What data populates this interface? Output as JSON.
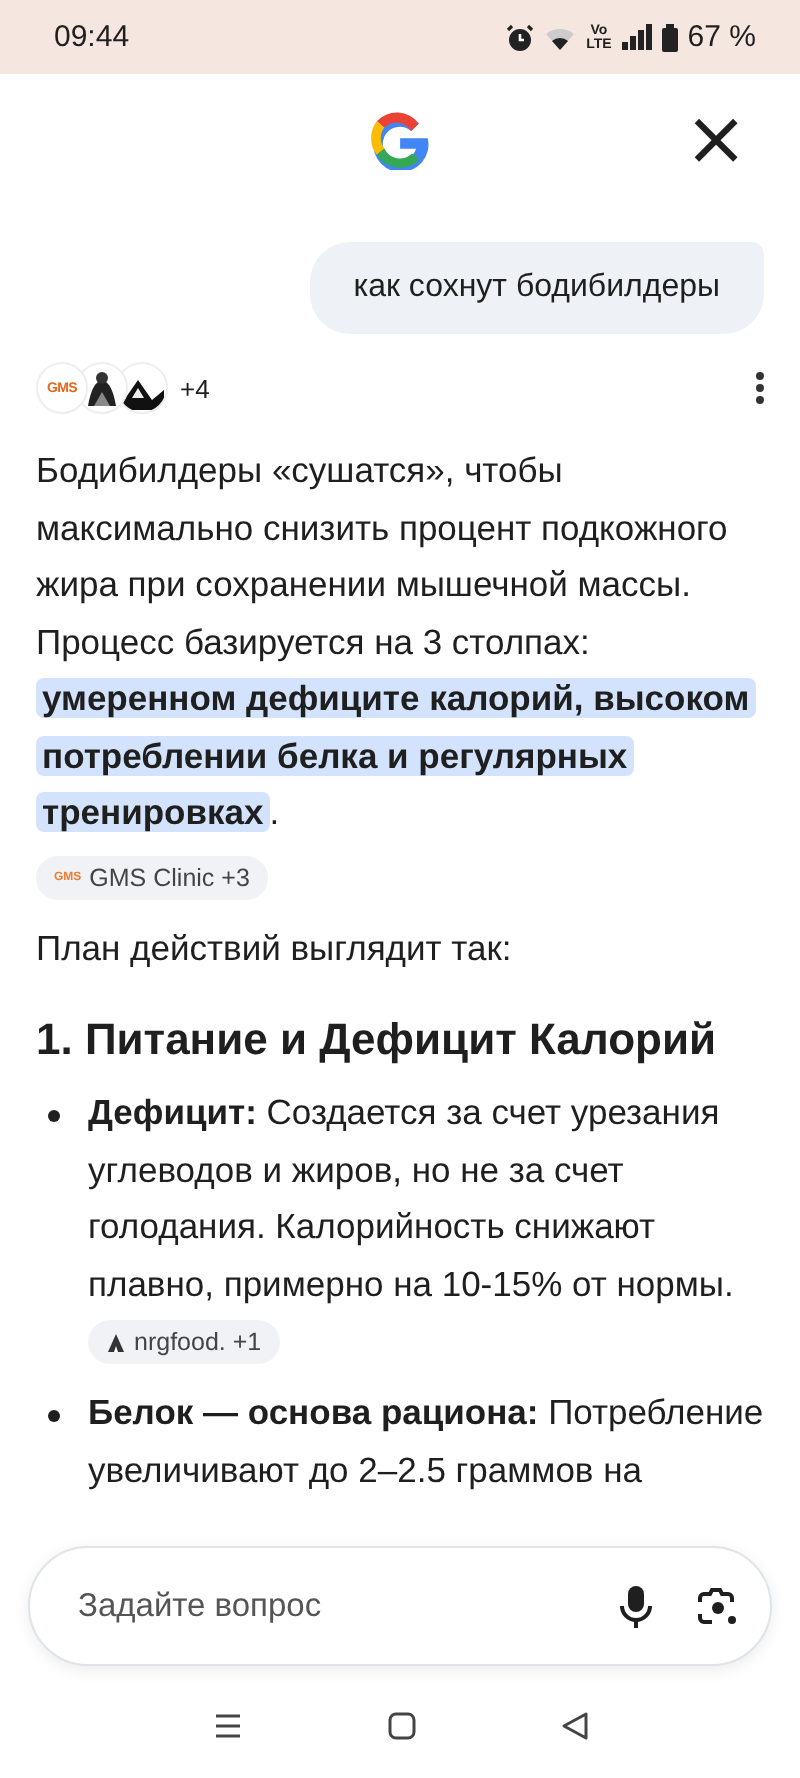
{
  "status_bar": {
    "time": "09:44",
    "network_badge": [
      "Vo",
      "LTE"
    ],
    "battery": "67 %"
  },
  "header": {
    "close": "×"
  },
  "query": "как сохнут бодибилдеры",
  "sources": {
    "avatars": [
      {
        "kind": "logo",
        "label": "GMS"
      },
      {
        "kind": "picture"
      },
      {
        "kind": "picture"
      }
    ],
    "more": "+4"
  },
  "intro": {
    "text": "Бодибилдеры «сушатся», чтобы максимально снизить процент подкожного жира при сохранении мышечной массы. Процесс базируется на 3 столпах: **умеренном дефиците калорий, высоком потреблении белка и регулярных тренировках**.",
    "chip": {
      "icon_label": "GMS",
      "label": "GMS Clinic +3"
    }
  },
  "plan": "План действий выглядит так:",
  "heading": "1. Питание и Дефицит Калорий",
  "bullets": [
    {
      "text": "**Дефицит:** Создается за счет урезания углеводов и жиров, но не за счет голодания. Калорийность снижают плавно, примерно на 10-15% от нормы.",
      "chip": {
        "label": "nrgfood. +1"
      }
    },
    {
      "text": "**Белок — основа рациона:** Потребление увеличивают до 2–2.5 граммов на"
    }
  ],
  "input": {
    "placeholder": "Задайте вопрос"
  }
}
